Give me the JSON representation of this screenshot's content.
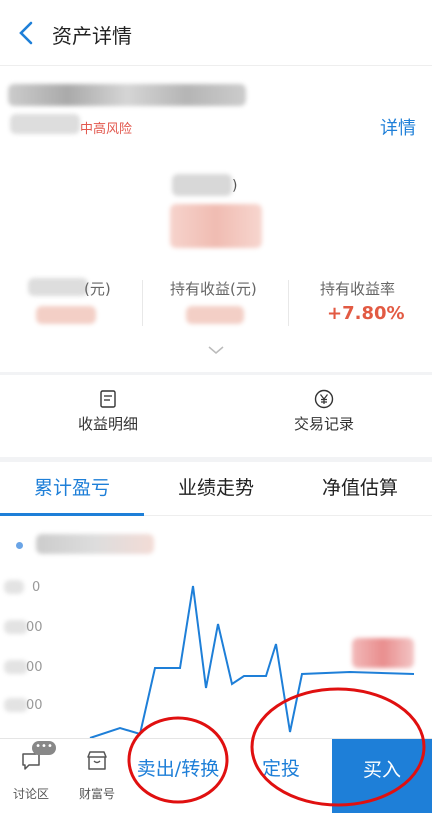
{
  "header": {
    "title": "资产详情",
    "back_icon": "chevron-left-icon"
  },
  "fund": {
    "risk_label": "中高风险",
    "detail_link": "详情",
    "paren_suffix": ")"
  },
  "stats": [
    {
      "label": "(元)",
      "value": ""
    },
    {
      "label": "持有收益(元)",
      "value": ""
    },
    {
      "label": "持有收益率",
      "value": "+7.80%"
    }
  ],
  "actions": [
    {
      "label": "收益明细",
      "icon": "document-icon"
    },
    {
      "label": "交易记录",
      "icon": "yuan-icon"
    }
  ],
  "tabs": [
    {
      "label": "累计盈亏",
      "active": true
    },
    {
      "label": "业绩走势",
      "active": false
    },
    {
      "label": "净值估算",
      "active": false
    }
  ],
  "chart": {
    "y_tick_suffixes": [
      "0",
      "00",
      "00",
      "00",
      "0"
    ],
    "line_color": "#1e7fd8"
  },
  "bottom_bar": {
    "discuss_label": "讨论区",
    "discuss_badge": "•••",
    "wealth_label": "财富号",
    "sell_label": "卖出/转换",
    "invest_label": "定投",
    "buy_label": "买入"
  },
  "colors": {
    "accent": "#1e7fd8",
    "gain": "#e25a43",
    "annotation": "#e01010"
  }
}
